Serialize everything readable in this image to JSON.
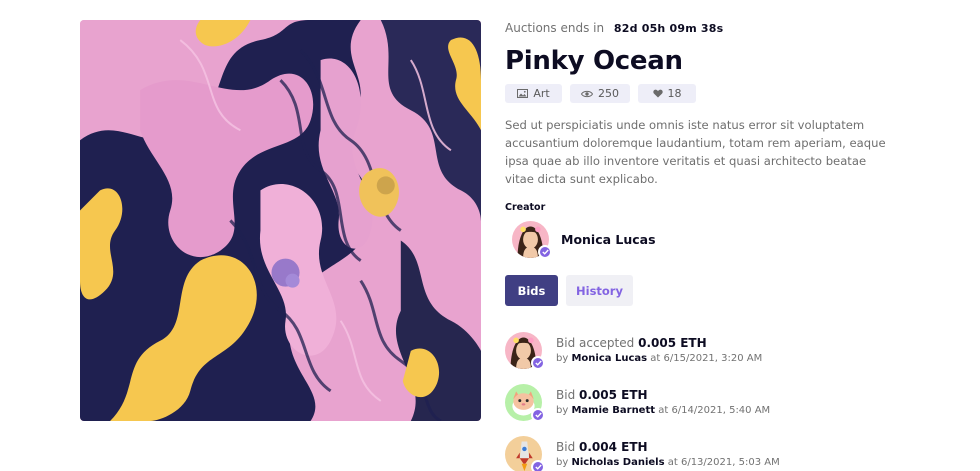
{
  "item": {
    "countdown_label": "Auctions ends in",
    "countdown_value": "82d 05h 09m 38s",
    "title": "Pinky Ocean",
    "category": "Art",
    "views": "250",
    "likes": "18",
    "description": "Sed ut perspiciatis unde omnis iste natus error sit voluptatem accusantium doloremque laudantium, totam rem aperiam, eaque ipsa quae ab illo inventore veritatis et quasi architecto beatae vitae dicta sunt explicabo."
  },
  "creator": {
    "label": "Creator",
    "name": "Monica Lucas"
  },
  "tabs": {
    "bids": "Bids",
    "history": "History"
  },
  "bids": [
    {
      "prefix": "Bid accepted",
      "amount": "0.005 ETH",
      "by": "by",
      "bidder": "Monica Lucas",
      "at": "at 6/15/2021, 3:20 AM"
    },
    {
      "prefix": "Bid",
      "amount": "0.005 ETH",
      "by": "by",
      "bidder": "Mamie Barnett",
      "at": "at 6/14/2021, 5:40 AM"
    },
    {
      "prefix": "Bid",
      "amount": "0.004 ETH",
      "by": "by",
      "bidder": "Nicholas Daniels",
      "at": "at 6/13/2021, 5:03 AM"
    }
  ],
  "icons": {
    "category": "image-icon",
    "views": "eye-icon",
    "likes": "heart-icon",
    "verified": "check-badge-icon"
  },
  "colors": {
    "primary_button": "#403f83",
    "accent": "#8364e2",
    "chip_bg": "#eeeef8",
    "art_pink": "#e9a0cf",
    "art_navy": "#1e1f4a",
    "art_yellow": "#f7c64e"
  }
}
